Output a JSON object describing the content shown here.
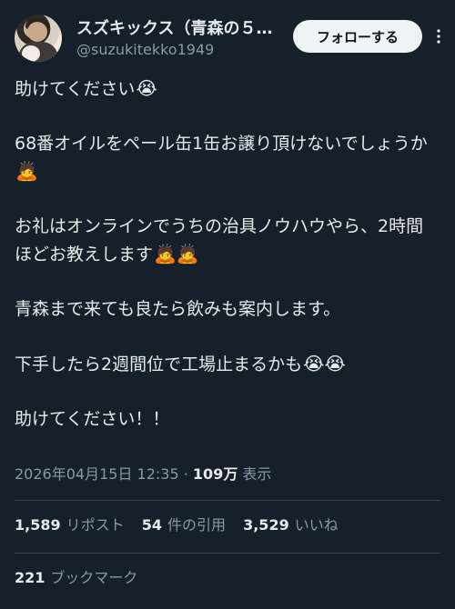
{
  "user": {
    "display_name": "スズキックス（青森の５…",
    "handle": "@suzukitekko1949"
  },
  "header": {
    "follow_label": "フォローする",
    "more_icon": "more-icon"
  },
  "tweet": {
    "lines": [
      {
        "text": "助けてください",
        "emoji": "😭"
      },
      {
        "text": "68番オイルをペール缶1缶お譲り頂けないでしょうか",
        "emoji": "🙇"
      },
      {
        "text": "お礼はオンラインでうちの治具ノウハウやら、2時間ほどお教えします",
        "emoji": "🙇🙇"
      },
      {
        "text": "青森まで来ても良たら飲みも案内します。",
        "emoji": ""
      },
      {
        "text": "下手したら2週間位で工場止まるかも",
        "emoji": "😭😭"
      },
      {
        "text": "助けてください！！",
        "emoji": ""
      }
    ]
  },
  "meta": {
    "timestamp": "2026年04月15日 12:35",
    "separator": "·",
    "views_count": "109万",
    "views_label": "表示"
  },
  "stats": {
    "reposts_count": "1,589",
    "reposts_label": "リポスト",
    "quotes_count": "54",
    "quotes_label": "件の引用",
    "likes_count": "3,529",
    "likes_label": "いいね",
    "bookmarks_count": "221",
    "bookmarks_label": "ブックマーク"
  },
  "colors": {
    "background": "#15202b",
    "text": "#e7e9ea",
    "secondary": "#8b98a5",
    "divider": "#38444d"
  }
}
